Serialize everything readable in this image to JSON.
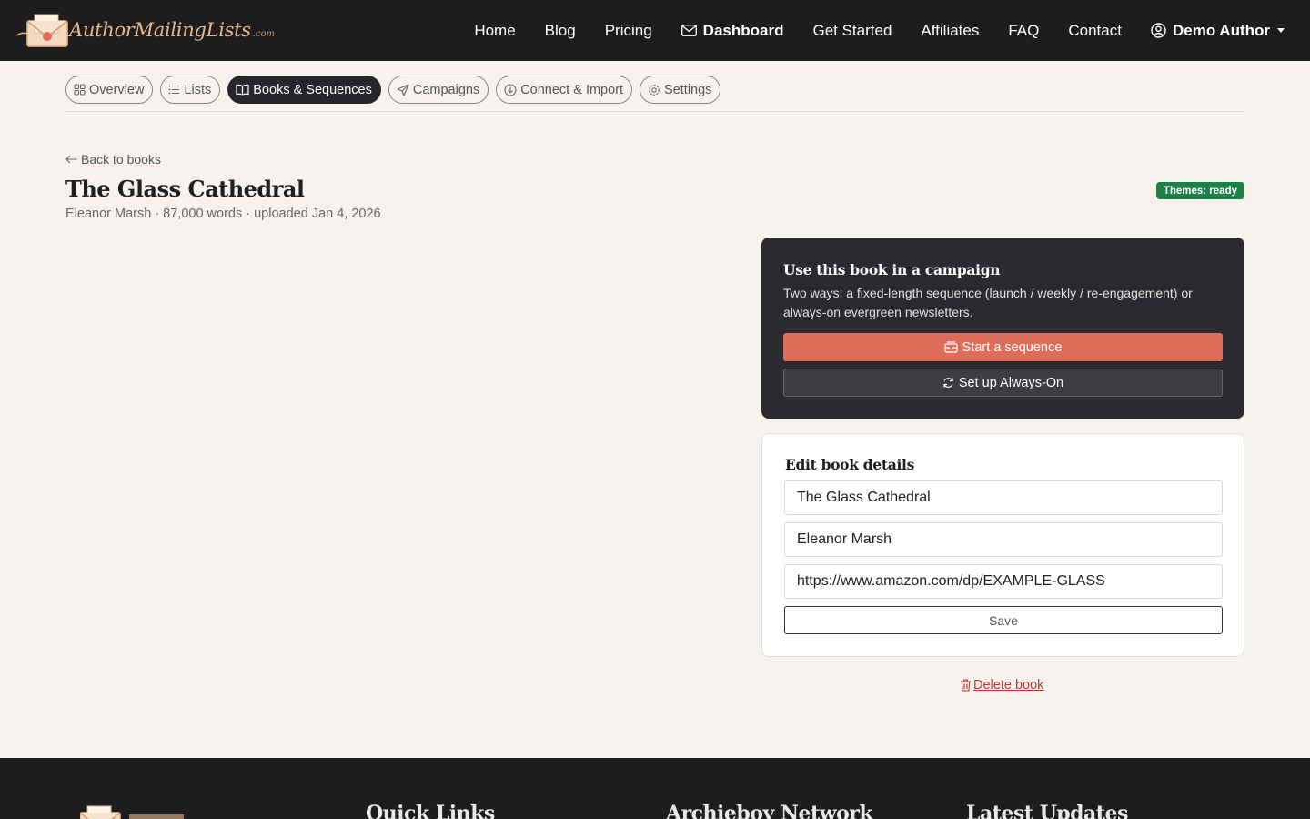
{
  "brand": {
    "name": "AuthorMailingLists",
    "suffix": ".com"
  },
  "nav": {
    "home": "Home",
    "blog": "Blog",
    "pricing": "Pricing",
    "dashboard": "Dashboard",
    "get_started": "Get Started",
    "affiliates": "Affiliates",
    "faq": "FAQ",
    "contact": "Contact",
    "user": "Demo Author"
  },
  "tabs": {
    "overview": "Overview",
    "lists": "Lists",
    "books": "Books & Sequences",
    "campaigns": "Campaigns",
    "connect": "Connect & Import",
    "settings": "Settings"
  },
  "book": {
    "back": "Back to books",
    "title": "The Glass Cathedral",
    "meta": "Eleanor Marsh · 87,000 words · uploaded Jan 4, 2026",
    "badge": "Themes: ready"
  },
  "campaign": {
    "heading": "Use this book in a campaign",
    "description": "Two ways: a fixed-length sequence (launch / weekly / re-engagement) or always-on evergreen newsletters.",
    "start_sequence": "Start a sequence",
    "always_on": "Set up Always-On"
  },
  "edit": {
    "heading": "Edit book details",
    "title_value": "The Glass Cathedral",
    "author_value": "Eleanor Marsh",
    "url_value": "https://www.amazon.com/dp/EXAMPLE-GLASS",
    "save": "Save"
  },
  "delete": "Delete book",
  "footer": {
    "quick_links": "Quick Links",
    "network": "Archieboy Network",
    "updates": "Latest Updates"
  },
  "colors": {
    "accent": "#e06c5a",
    "dark": "#1d1d20",
    "badge": "#1d8049",
    "danger": "#c0392b"
  }
}
